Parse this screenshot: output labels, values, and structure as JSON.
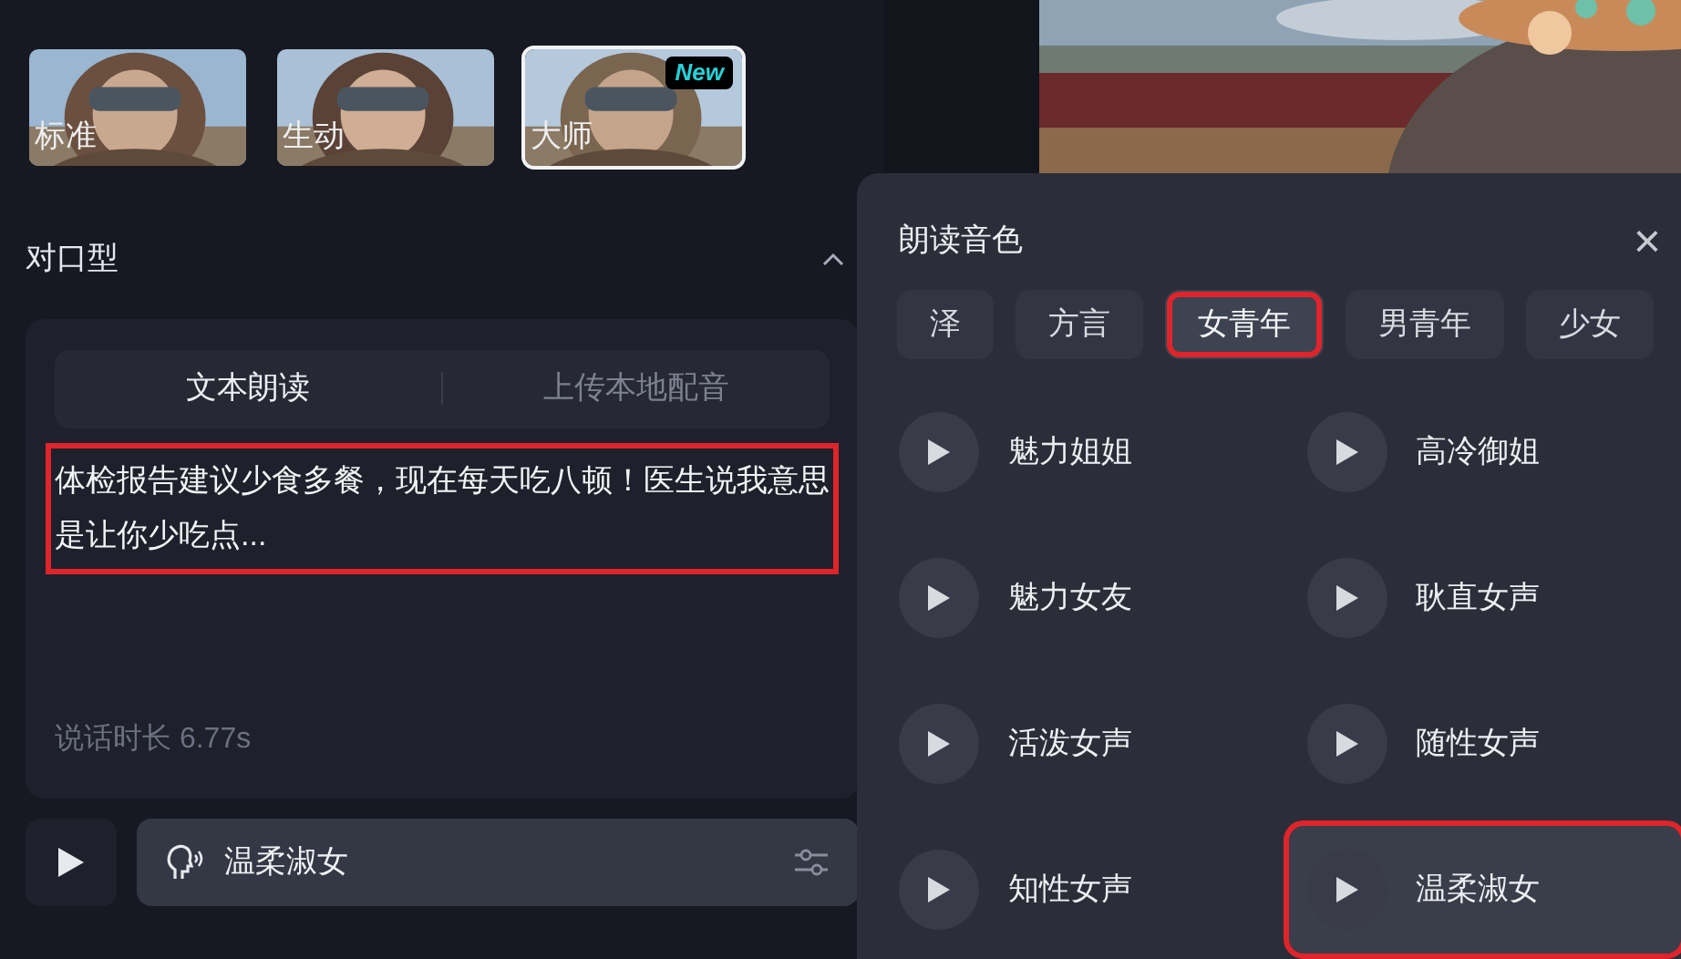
{
  "presets": [
    {
      "label": "标准",
      "selected": false
    },
    {
      "label": "生动",
      "selected": false
    },
    {
      "label": "大师",
      "selected": true,
      "badge": "New"
    }
  ],
  "lip_sync": {
    "title": "对口型",
    "expanded": true,
    "tabs": [
      {
        "label": "文本朗读",
        "selected": true
      },
      {
        "label": "上传本地配音",
        "selected": false
      }
    ],
    "script_text": "体检报告建议少食多餐，现在每天吃八顿！医生说我意思是让你少吃点...",
    "script_highlighted": true,
    "duration": "说话时长 6.77s",
    "voice": "温柔淑女"
  },
  "voice_panel": {
    "title": "朗读音色",
    "close": "×",
    "categories": [
      {
        "label": "泽",
        "selected": false,
        "highlighted": false
      },
      {
        "label": "方言",
        "selected": false,
        "highlighted": false
      },
      {
        "label": "女青年",
        "selected": true,
        "highlighted": true
      },
      {
        "label": "男青年",
        "selected": false,
        "highlighted": false
      },
      {
        "label": "少女",
        "selected": false,
        "highlighted": false
      }
    ],
    "voices": [
      {
        "name": "魅力姐姐",
        "selected": false
      },
      {
        "name": "高冷御姐",
        "selected": false
      },
      {
        "name": "魅力女友",
        "selected": false
      },
      {
        "name": "耿直女声",
        "selected": false
      },
      {
        "name": "活泼女声",
        "selected": false
      },
      {
        "name": "随性女声",
        "selected": false
      },
      {
        "name": "知性女声",
        "selected": false
      },
      {
        "name": "温柔淑女",
        "selected": true
      }
    ]
  }
}
